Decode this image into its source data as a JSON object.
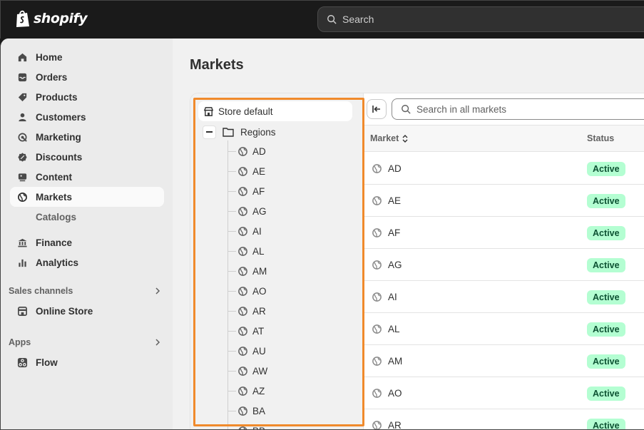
{
  "brand": {
    "name": "shopify"
  },
  "topbar": {
    "search_placeholder": "Search"
  },
  "sidebar": {
    "items": [
      {
        "label": "Home",
        "icon": "home-icon"
      },
      {
        "label": "Orders",
        "icon": "inbox-icon"
      },
      {
        "label": "Products",
        "icon": "tag-icon"
      },
      {
        "label": "Customers",
        "icon": "person-icon"
      },
      {
        "label": "Marketing",
        "icon": "target-icon"
      },
      {
        "label": "Discounts",
        "icon": "discount-icon"
      },
      {
        "label": "Content",
        "icon": "content-icon"
      },
      {
        "label": "Markets",
        "icon": "globe-icon",
        "active": true
      }
    ],
    "sub_items": [
      {
        "label": "Catalogs"
      }
    ],
    "items2": [
      {
        "label": "Finance",
        "icon": "bank-icon"
      },
      {
        "label": "Analytics",
        "icon": "bar-chart-icon"
      }
    ],
    "sales_channels_label": "Sales channels",
    "online_store_label": "Online Store",
    "apps_label": "Apps",
    "flow_label": "Flow"
  },
  "page": {
    "title": "Markets"
  },
  "tree": {
    "root_label": "Store default",
    "regions_label": "Regions",
    "nodes": [
      "AD",
      "AE",
      "AF",
      "AG",
      "AI",
      "AL",
      "AM",
      "AO",
      "AR",
      "AT",
      "AU",
      "AW",
      "AZ",
      "BA",
      "BB"
    ]
  },
  "table": {
    "search_placeholder": "Search in all markets",
    "col_market": "Market",
    "col_status": "Status",
    "rows": [
      {
        "market": "AD",
        "status": "Active"
      },
      {
        "market": "AE",
        "status": "Active"
      },
      {
        "market": "AF",
        "status": "Active"
      },
      {
        "market": "AG",
        "status": "Active"
      },
      {
        "market": "AI",
        "status": "Active"
      },
      {
        "market": "AL",
        "status": "Active"
      },
      {
        "market": "AM",
        "status": "Active"
      },
      {
        "market": "AO",
        "status": "Active"
      },
      {
        "market": "AR",
        "status": "Active"
      }
    ]
  },
  "colors": {
    "highlight": "#f08a2c",
    "badge_bg": "#b4fed2",
    "badge_fg": "#0c5132"
  }
}
